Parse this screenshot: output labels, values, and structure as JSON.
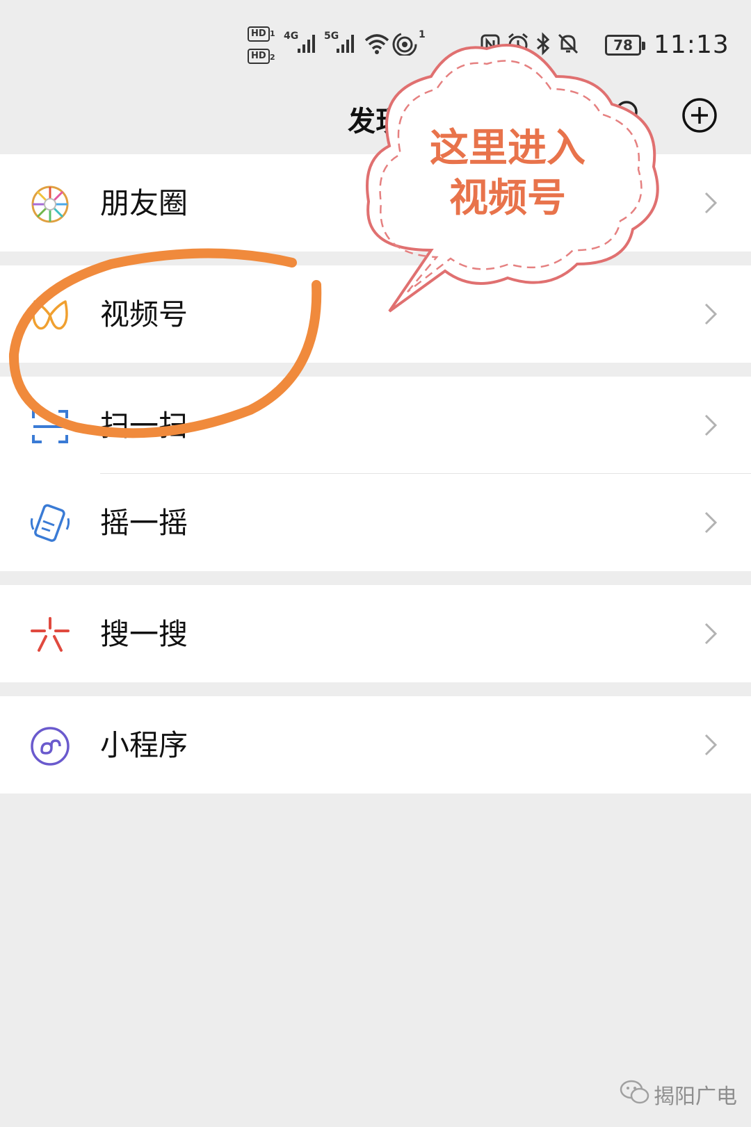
{
  "status_bar": {
    "hd1": "HD",
    "hd2": "HD",
    "sim1": "1",
    "sim2": "2",
    "net1": "4G",
    "net2": "5G",
    "hotspot_count": "1",
    "battery": "78",
    "time": "11:13"
  },
  "header": {
    "title": "发现"
  },
  "menu": {
    "moments": "朋友圈",
    "channels": "视频号",
    "scan": "扫一扫",
    "shake": "摇一摇",
    "search": "搜一搜",
    "mini_programs": "小程序"
  },
  "annotation": {
    "line1": "这里进入",
    "line2": "视频号",
    "callout_color": "#e8734b",
    "circle_color": "#f08a3c"
  },
  "watermark": {
    "text": "揭阳广电"
  }
}
